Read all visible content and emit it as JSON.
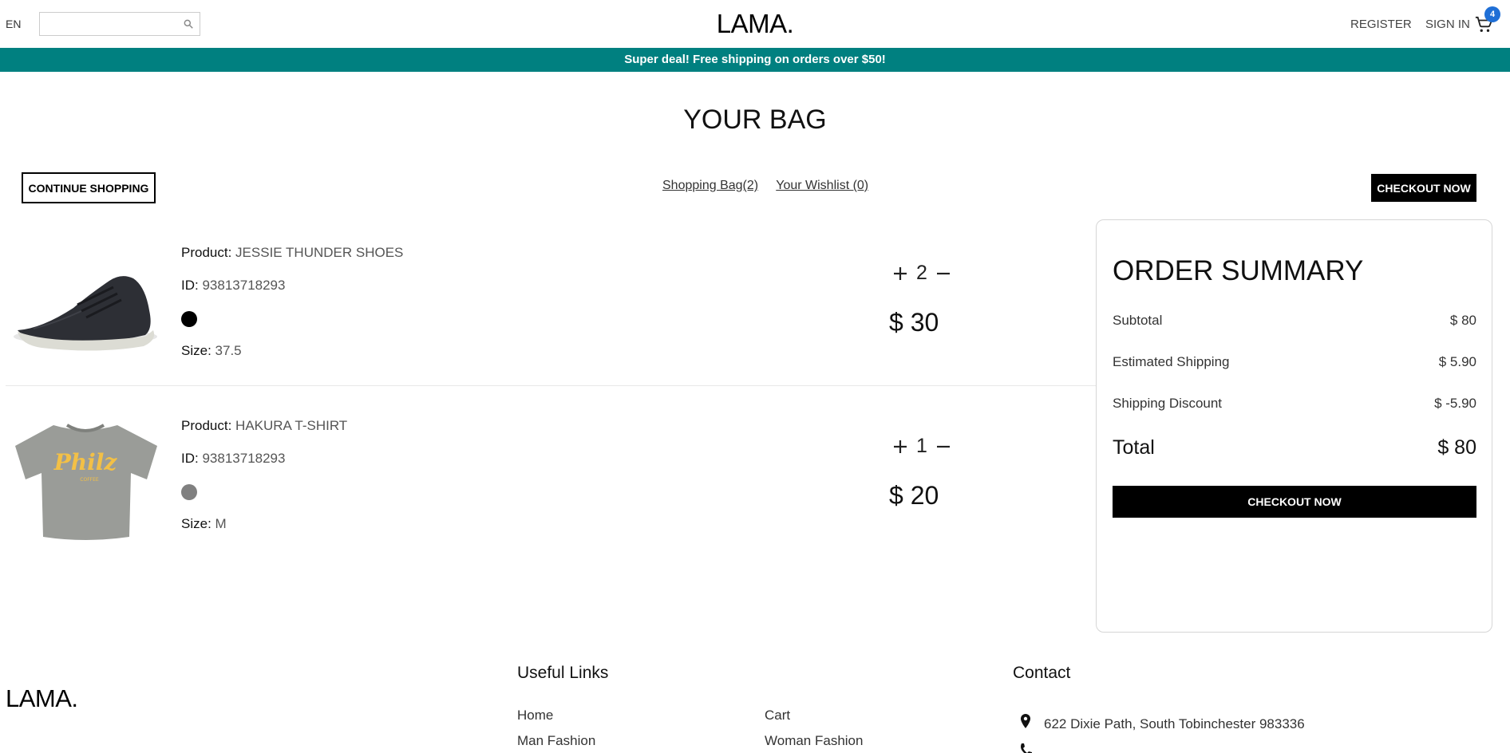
{
  "navbar": {
    "language": "EN",
    "search_placeholder": "",
    "logo": "LAMA.",
    "register_label": "REGISTER",
    "signin_label": "SIGN IN",
    "cart_count": "4"
  },
  "announcement": "Super deal! Free shipping on orders over $50!",
  "page_title": "YOUR BAG",
  "top": {
    "continue_label": "CONTINUE SHOPPING",
    "shopping_bag_label": "Shopping Bag(2)",
    "wishlist_label": "Your Wishlist (0)",
    "checkout_label": "CHECKOUT NOW"
  },
  "labels": {
    "product": "Product:",
    "id": "ID:",
    "size": "Size:"
  },
  "products": [
    {
      "name": "JESSIE THUNDER SHOES",
      "id": "93813718293",
      "color": "#000000",
      "size": "37.5",
      "quantity": "2",
      "price": "$ 30"
    },
    {
      "name": "HAKURA T-SHIRT",
      "id": "93813718293",
      "color": "#808080",
      "size": "M",
      "quantity": "1",
      "price": "$ 20"
    }
  ],
  "summary": {
    "title": "ORDER SUMMARY",
    "rows": [
      {
        "label": "Subtotal",
        "value": "$ 80"
      },
      {
        "label": "Estimated Shipping",
        "value": "$ 5.90"
      },
      {
        "label": "Shipping Discount",
        "value": "$ -5.90"
      }
    ],
    "total_label": "Total",
    "total_value": "$ 80",
    "checkout_label": "CHECKOUT NOW"
  },
  "footer": {
    "logo": "LAMA.",
    "useful_links_title": "Useful Links",
    "links_col1": [
      "Home",
      "Man Fashion"
    ],
    "links_col2": [
      "Cart",
      "Woman Fashion"
    ],
    "contact_title": "Contact",
    "address": "622 Dixie Path, South Tobinchester 983336"
  },
  "colors": {
    "announcement_bg": "#008080",
    "badge": "#1f6fd6",
    "accent": "#000000"
  }
}
